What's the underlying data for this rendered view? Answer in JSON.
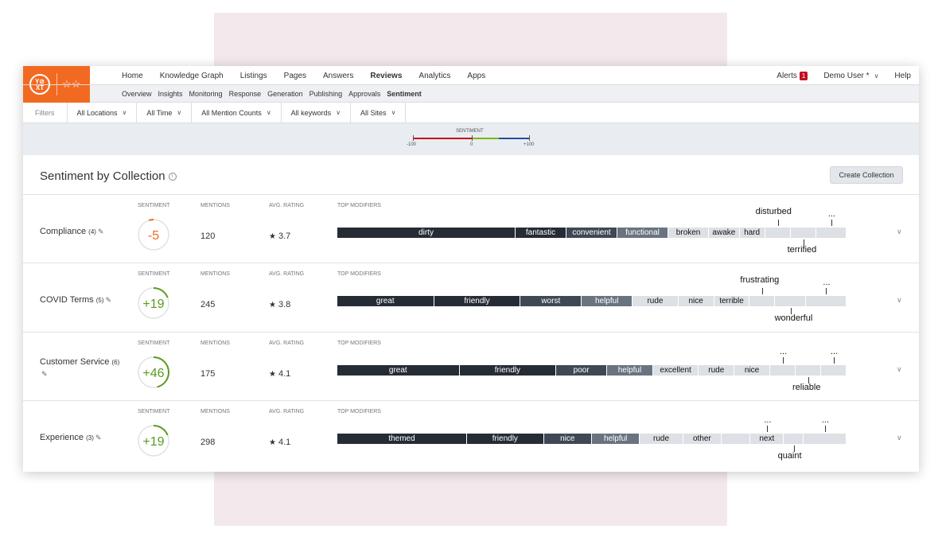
{
  "brand": {
    "logo_text": "YEXT",
    "accent": "#f26a21"
  },
  "nav": {
    "items": [
      "Home",
      "Knowledge Graph",
      "Listings",
      "Pages",
      "Answers",
      "Reviews",
      "Analytics",
      "Apps"
    ],
    "active": "Reviews",
    "alerts_label": "Alerts",
    "alerts_count": "1",
    "user": "Demo User *",
    "help": "Help"
  },
  "subnav": {
    "items": [
      "Overview",
      "Insights",
      "Monitoring",
      "Response",
      "Generation",
      "Publishing",
      "Approvals",
      "Sentiment"
    ],
    "active": "Sentiment"
  },
  "filters": {
    "label": "Filters",
    "items": [
      "All Locations",
      "All Time",
      "All Mention Counts",
      "All keywords",
      "All Sites"
    ]
  },
  "legend": {
    "title": "SENTIMENT",
    "min": "-100",
    "mid": "0",
    "max": "+100",
    "colors": [
      "#c0111f",
      "#7ab800",
      "#1f4fa0"
    ]
  },
  "section": {
    "title": "Sentiment by Collection",
    "info": "i",
    "create_button": "Create Collection"
  },
  "columns": {
    "sentiment": "SENTIMENT",
    "mentions": "MENTIONS",
    "rating": "AVG. RATING",
    "modifiers": "TOP MODIFIERS"
  },
  "collections": [
    {
      "name": "Compliance",
      "count": "(4)",
      "sentiment": "-5",
      "sentiment_value": -5,
      "mentions": "120",
      "rating": "3.7",
      "modifiers": [
        {
          "label": "dirty",
          "weight": 35,
          "tone": "dark"
        },
        {
          "label": "fantastic",
          "weight": 10,
          "tone": "dark"
        },
        {
          "label": "convenient",
          "weight": 10,
          "tone": "mid"
        },
        {
          "label": "functional",
          "weight": 10,
          "tone": "slate"
        },
        {
          "label": "broken",
          "weight": 8,
          "tone": "light"
        },
        {
          "label": "awake",
          "weight": 6,
          "tone": "light"
        },
        {
          "label": "hard",
          "weight": 5,
          "tone": "light"
        },
        {
          "label": "",
          "weight": 5,
          "tone": "light"
        },
        {
          "label": "",
          "weight": 5,
          "tone": "light"
        },
        {
          "label": "",
          "weight": 6,
          "tone": "light"
        }
      ],
      "above": [
        "disturbed",
        "..."
      ],
      "below": [
        "terrified"
      ]
    },
    {
      "name": "COVID Terms",
      "count": "(5)",
      "sentiment": "+19",
      "sentiment_value": 19,
      "mentions": "245",
      "rating": "3.8",
      "modifiers": [
        {
          "label": "great",
          "weight": 19,
          "tone": "dark"
        },
        {
          "label": "friendly",
          "weight": 17,
          "tone": "dark"
        },
        {
          "label": "worst",
          "weight": 12,
          "tone": "mid"
        },
        {
          "label": "helpful",
          "weight": 10,
          "tone": "slate"
        },
        {
          "label": "rude",
          "weight": 9,
          "tone": "light"
        },
        {
          "label": "nice",
          "weight": 7,
          "tone": "light"
        },
        {
          "label": "terrible",
          "weight": 7,
          "tone": "light"
        },
        {
          "label": "",
          "weight": 5,
          "tone": "light"
        },
        {
          "label": "",
          "weight": 6,
          "tone": "light"
        },
        {
          "label": "",
          "weight": 8,
          "tone": "light"
        }
      ],
      "above": [
        "frustrating",
        "..."
      ],
      "below": [
        "wonderful"
      ]
    },
    {
      "name": "Customer Service",
      "count": "(6)",
      "sentiment": "+46",
      "sentiment_value": 46,
      "mentions": "175",
      "rating": "4.1",
      "modifiers": [
        {
          "label": "great",
          "weight": 24,
          "tone": "dark"
        },
        {
          "label": "friendly",
          "weight": 19,
          "tone": "dark"
        },
        {
          "label": "poor",
          "weight": 10,
          "tone": "mid"
        },
        {
          "label": "helpful",
          "weight": 9,
          "tone": "slate"
        },
        {
          "label": "excellent",
          "weight": 9,
          "tone": "light"
        },
        {
          "label": "rude",
          "weight": 7,
          "tone": "light"
        },
        {
          "label": "nice",
          "weight": 7,
          "tone": "light"
        },
        {
          "label": "",
          "weight": 5,
          "tone": "light"
        },
        {
          "label": "",
          "weight": 5,
          "tone": "light"
        },
        {
          "label": "",
          "weight": 5,
          "tone": "light"
        }
      ],
      "above": [
        "...",
        "..."
      ],
      "below": [
        "reliable"
      ]
    },
    {
      "name": "Experience",
      "count": "(3)",
      "sentiment": "+19",
      "sentiment_value": 19,
      "mentions": "298",
      "rating": "4.1",
      "modifiers": [
        {
          "label": "themed",
          "weight": 27,
          "tone": "dark"
        },
        {
          "label": "friendly",
          "weight": 16,
          "tone": "dark"
        },
        {
          "label": "nice",
          "weight": 10,
          "tone": "mid"
        },
        {
          "label": "helpful",
          "weight": 10,
          "tone": "slate"
        },
        {
          "label": "rude",
          "weight": 9,
          "tone": "light"
        },
        {
          "label": "other",
          "weight": 8,
          "tone": "light"
        },
        {
          "label": "",
          "weight": 6,
          "tone": "light"
        },
        {
          "label": "next",
          "weight": 7,
          "tone": "light"
        },
        {
          "label": "",
          "weight": 4,
          "tone": "light"
        },
        {
          "label": "",
          "weight": 9,
          "tone": "light"
        }
      ],
      "above": [
        "...",
        "..."
      ],
      "below": [
        "quaint"
      ]
    }
  ]
}
